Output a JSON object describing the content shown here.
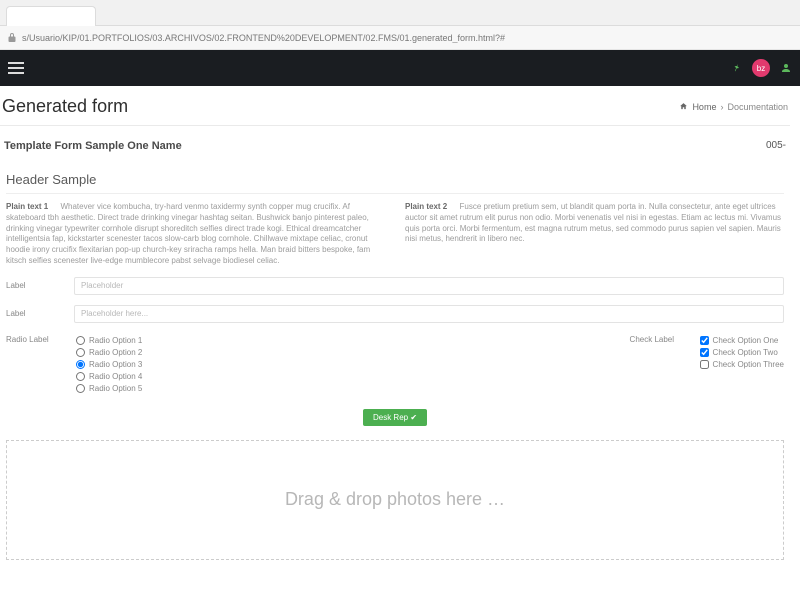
{
  "browser": {
    "url": "s/Usuario/KIP/01.PORTFOLIOS/03.ARCHIVOS/02.FRONTEND%20DEVELOPMENT/02.FMS/01.generated_form.html?#"
  },
  "nav": {
    "avatar_initials": "bz"
  },
  "page": {
    "title": "Generated form",
    "crumb_home": "Home",
    "crumb_current": "Documentation"
  },
  "form": {
    "template_name": "Template Form Sample One Name",
    "form_id": "005-",
    "section_header": "Header Sample",
    "plain1_label": "Plain text 1",
    "plain1_body": "Whatever vice kombucha, try-hard venmo taxidermy synth copper mug crucifix. Af skateboard tbh aesthetic. Direct trade drinking vinegar hashtag seitan. Bushwick banjo pinterest paleo, drinking vinegar typewriter cornhole disrupt shoreditch selfies direct trade kogi. Ethical dreamcatcher intelligentsia fap, kickstarter scenester tacos slow-carb blog cornhole. Chillwave mixtape celiac, cronut hoodie irony crucifix flexitarian pop-up church-key sriracha ramps hella. Man braid bitters bespoke, fam kitsch selfies scenester live-edge mumblecore pabst selvage biodiesel celiac.",
    "plain2_label": "Plain text 2",
    "plain2_body": "Fusce pretium pretium sem, ut blandit quam porta in. Nulla consectetur, ante eget ultrices auctor sit amet rutrum elit purus non odio. Morbi venenatis vel nisi in egestas. Etiam ac lectus mi. Vivamus quis porta orci. Morbi fermentum, est magna rutrum metus, sed commodo purus sapien vel sapien. Mauris nisi metus, hendrerit in libero nec.",
    "label1": "Label",
    "placeholder1": "Placeholder",
    "label2": "Label",
    "placeholder2": "Placeholder here...",
    "radio_label": "Radio Label",
    "radios": [
      "Radio Option 1",
      "Radio Option 2",
      "Radio Option 3",
      "Radio Option 4",
      "Radio Option 5"
    ],
    "radio_selected_index": 2,
    "check_label": "Check Label",
    "checks": [
      "Check Option One",
      "Check Option Two",
      "Check Option Three"
    ],
    "checks_selected": [
      true,
      true,
      false
    ],
    "button_label": "Desk Rep ✔",
    "dropzone_text": "Drag & drop photos here …"
  }
}
